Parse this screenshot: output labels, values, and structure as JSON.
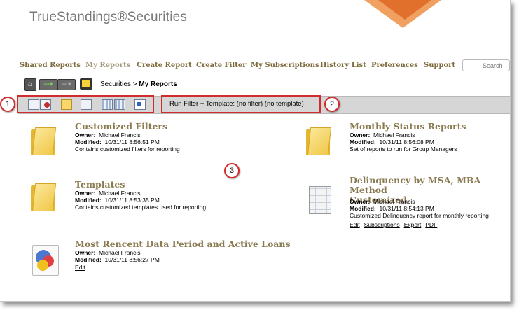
{
  "app": {
    "title": "TrueStandings®Securities"
  },
  "nav": {
    "items": [
      "Shared Reports",
      "My Reports",
      "Create Report",
      "Create Filter",
      "My Subscriptions",
      "History List",
      "Preferences",
      "Support"
    ],
    "search_placeholder": "Search"
  },
  "breadcrumb": {
    "parent": "Securities",
    "separator": ">",
    "current": "My Reports"
  },
  "toolbar": {
    "filter_text": "Run Filter + Template:   (no filter)   (no template)"
  },
  "callouts": [
    "1",
    "2",
    "3"
  ],
  "items": [
    {
      "title": "Customized Filters",
      "owner_label": "Owner:",
      "owner": "Michael Francis",
      "modified_label": "Modified:",
      "modified": "10/31/11 8:56:51 PM",
      "description": "Contains customized filters for reporting"
    },
    {
      "title": "Monthly Status Reports",
      "owner_label": "Owner:",
      "owner": "Michael Francis",
      "modified_label": "Modified:",
      "modified": "10/31/11 8:56:08 PM",
      "description": "Set of reports to run for Group Managers"
    },
    {
      "title": "Templates",
      "owner_label": "Owner:",
      "owner": "Michael Francis",
      "modified_label": "Modified:",
      "modified": "10/31/11 8:53:35 PM",
      "description": "Contains customized templates used for reporting"
    },
    {
      "title_line1": "Delinquency by MSA, MBA Method",
      "title_line2": "Customized",
      "owner_label": "Owner:",
      "owner": "Michael Francis",
      "modified_label": "Modified:",
      "modified": "10/31/11 8:54:13 PM",
      "description": "Customized Delinquency report for monthly reporting",
      "links": [
        "Edit",
        "Subscriptions",
        "Export",
        "PDF"
      ]
    },
    {
      "title": "Most Rencent Data Period and Active Loans",
      "owner_label": "Owner:",
      "owner": "Michael Francis",
      "modified_label": "Modified:",
      "modified": "10/31/11 8:56:27 PM",
      "links": [
        "Edit"
      ]
    }
  ],
  "colors": {
    "accent_title": "#8a7a50",
    "nav_link": "#7d6a3a",
    "callout": "#d22b2b",
    "brand_orange": "#e0702c"
  }
}
